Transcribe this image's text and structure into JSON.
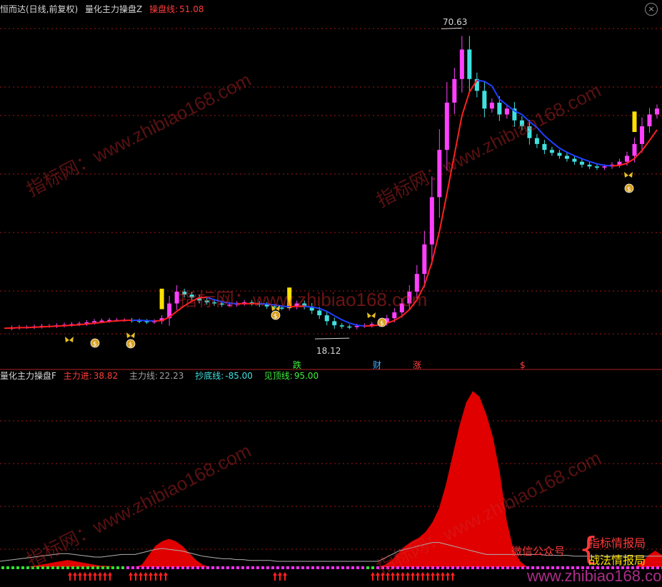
{
  "top_header": {
    "stock_name": "恒而达(日线,前复权)",
    "indicator_name": "量化主力操盘Z",
    "control_label": "操盘线:",
    "control_value": "51.08"
  },
  "bottom_header": {
    "indicator_name": "量化主力操盘F",
    "items": [
      {
        "label": "主力进:",
        "value": "38.82",
        "color": "#ff3b3b"
      },
      {
        "label": "主力线:",
        "value": "22.23",
        "color": "#a0a0a0"
      },
      {
        "label": "抄底线:",
        "value": "-85.00",
        "color": "#40e0e0"
      },
      {
        "label": "见顶线:",
        "value": "95.00",
        "color": "#3cf03c"
      }
    ]
  },
  "price_annotations": {
    "high_label": "70.63",
    "low_label": "18.12"
  },
  "signal_labels": [
    {
      "text": "跌",
      "color": "#3cf03c"
    },
    {
      "text": "财",
      "color": "#40b0ff"
    },
    {
      "text": "涨",
      "color": "#ff4040"
    },
    {
      "text": "$",
      "color": "#ff4040"
    }
  ],
  "watermark_text": "指标网：www.zhibiao168.com",
  "watermark_bottom": "www.zhibiao168.com",
  "promo": {
    "label": "微信公众号",
    "line1": "指标情报局",
    "line2": "战法情报局"
  },
  "colors": {
    "up": "#ff40ff",
    "down": "#40e0e0",
    "signal_bar": "#ffe000",
    "ma_up": "#ff2020",
    "ma_down": "#2040ff",
    "volume_area": "#e00000",
    "grid": "#a01818"
  },
  "icons": [
    "money-bag-icon",
    "butterfly-icon",
    "close-icon"
  ],
  "chart_data": [
    {
      "type": "candlestick",
      "title": "量化主力操盘Z",
      "ylim": [
        15,
        72
      ],
      "high_point": 70.63,
      "low_point": 18.12,
      "close_series_approx": [
        19.8,
        19.9,
        20.0,
        20.0,
        20.1,
        20.2,
        20.2,
        20.3,
        20.4,
        20.5,
        20.6,
        20.8,
        21.0,
        21.1,
        21.2,
        21.2,
        21.2,
        21.1,
        21.0,
        20.9,
        21.0,
        21.5,
        24.0,
        26.0,
        25.5,
        25.0,
        24.5,
        24.2,
        24.0,
        23.8,
        23.8,
        24.0,
        24.2,
        24.0,
        23.8,
        23.5,
        23.3,
        23.2,
        23.5,
        24.0,
        23.5,
        22.8,
        22.0,
        21.0,
        20.3,
        20.1,
        20.0,
        20.2,
        20.3,
        20.5,
        20.8,
        21.5,
        22.5,
        24.0,
        26.0,
        29.0,
        34.0,
        42.0,
        50.0,
        58.0,
        62.0,
        67.0,
        62.0,
        60.0,
        57.0,
        58.0,
        56.0,
        57.0,
        55.0,
        54.0,
        52.0,
        51.0,
        50.0,
        49.5,
        49.0,
        48.5,
        48.0,
        47.5,
        47.2,
        47.0,
        47.2,
        47.5,
        48.0,
        49.0,
        51.0,
        54.0,
        56.0,
        57.0
      ]
    },
    {
      "type": "area",
      "title": "量化主力操盘F",
      "series": [
        {
          "name": "主力进",
          "values": [
            0,
            0,
            0,
            0,
            0,
            1,
            2,
            3,
            4,
            5,
            6,
            5,
            4,
            3,
            2,
            1,
            1,
            0,
            0,
            0,
            0,
            2,
            10,
            18,
            22,
            24,
            22,
            18,
            12,
            6,
            2,
            0,
            0,
            0,
            0,
            0,
            0,
            0,
            0,
            0,
            0,
            0,
            0,
            0,
            0,
            0,
            0,
            0,
            0,
            0,
            0,
            0,
            0,
            0,
            0,
            0,
            0,
            2,
            6,
            12,
            18,
            22,
            25,
            30,
            38,
            50,
            70,
            95,
            120,
            140,
            150,
            145,
            130,
            110,
            80,
            40,
            15,
            5,
            0,
            0,
            0,
            0,
            0,
            0,
            0,
            0,
            0,
            0,
            0,
            0,
            0,
            0,
            0,
            0,
            0,
            4,
            10,
            14,
            10
          ]
        },
        {
          "name": "主力线",
          "values": [
            0,
            1,
            2,
            3,
            4,
            5,
            6,
            7,
            8,
            9,
            9,
            8,
            7,
            6,
            5,
            5,
            6,
            7,
            8,
            8,
            8,
            10,
            12,
            14,
            15,
            14,
            13,
            12,
            10,
            8,
            6,
            5,
            4,
            3,
            3,
            2,
            2,
            1,
            1,
            1,
            1,
            0,
            0,
            0,
            0,
            0,
            0,
            0,
            0,
            0,
            0,
            0,
            0,
            0,
            0,
            0,
            0,
            4,
            8,
            12,
            14,
            16,
            18,
            20,
            22,
            22,
            20,
            18,
            16,
            14,
            12,
            10,
            8,
            8,
            8,
            8,
            8,
            8,
            8,
            8,
            8,
            7,
            7,
            7,
            7,
            6,
            6,
            6,
            6,
            6,
            6,
            6,
            6,
            6,
            6,
            6,
            6,
            6,
            6,
            6
          ]
        }
      ],
      "reference_lines": {
        "抄底线": -85,
        "见顶线": 95
      }
    }
  ]
}
